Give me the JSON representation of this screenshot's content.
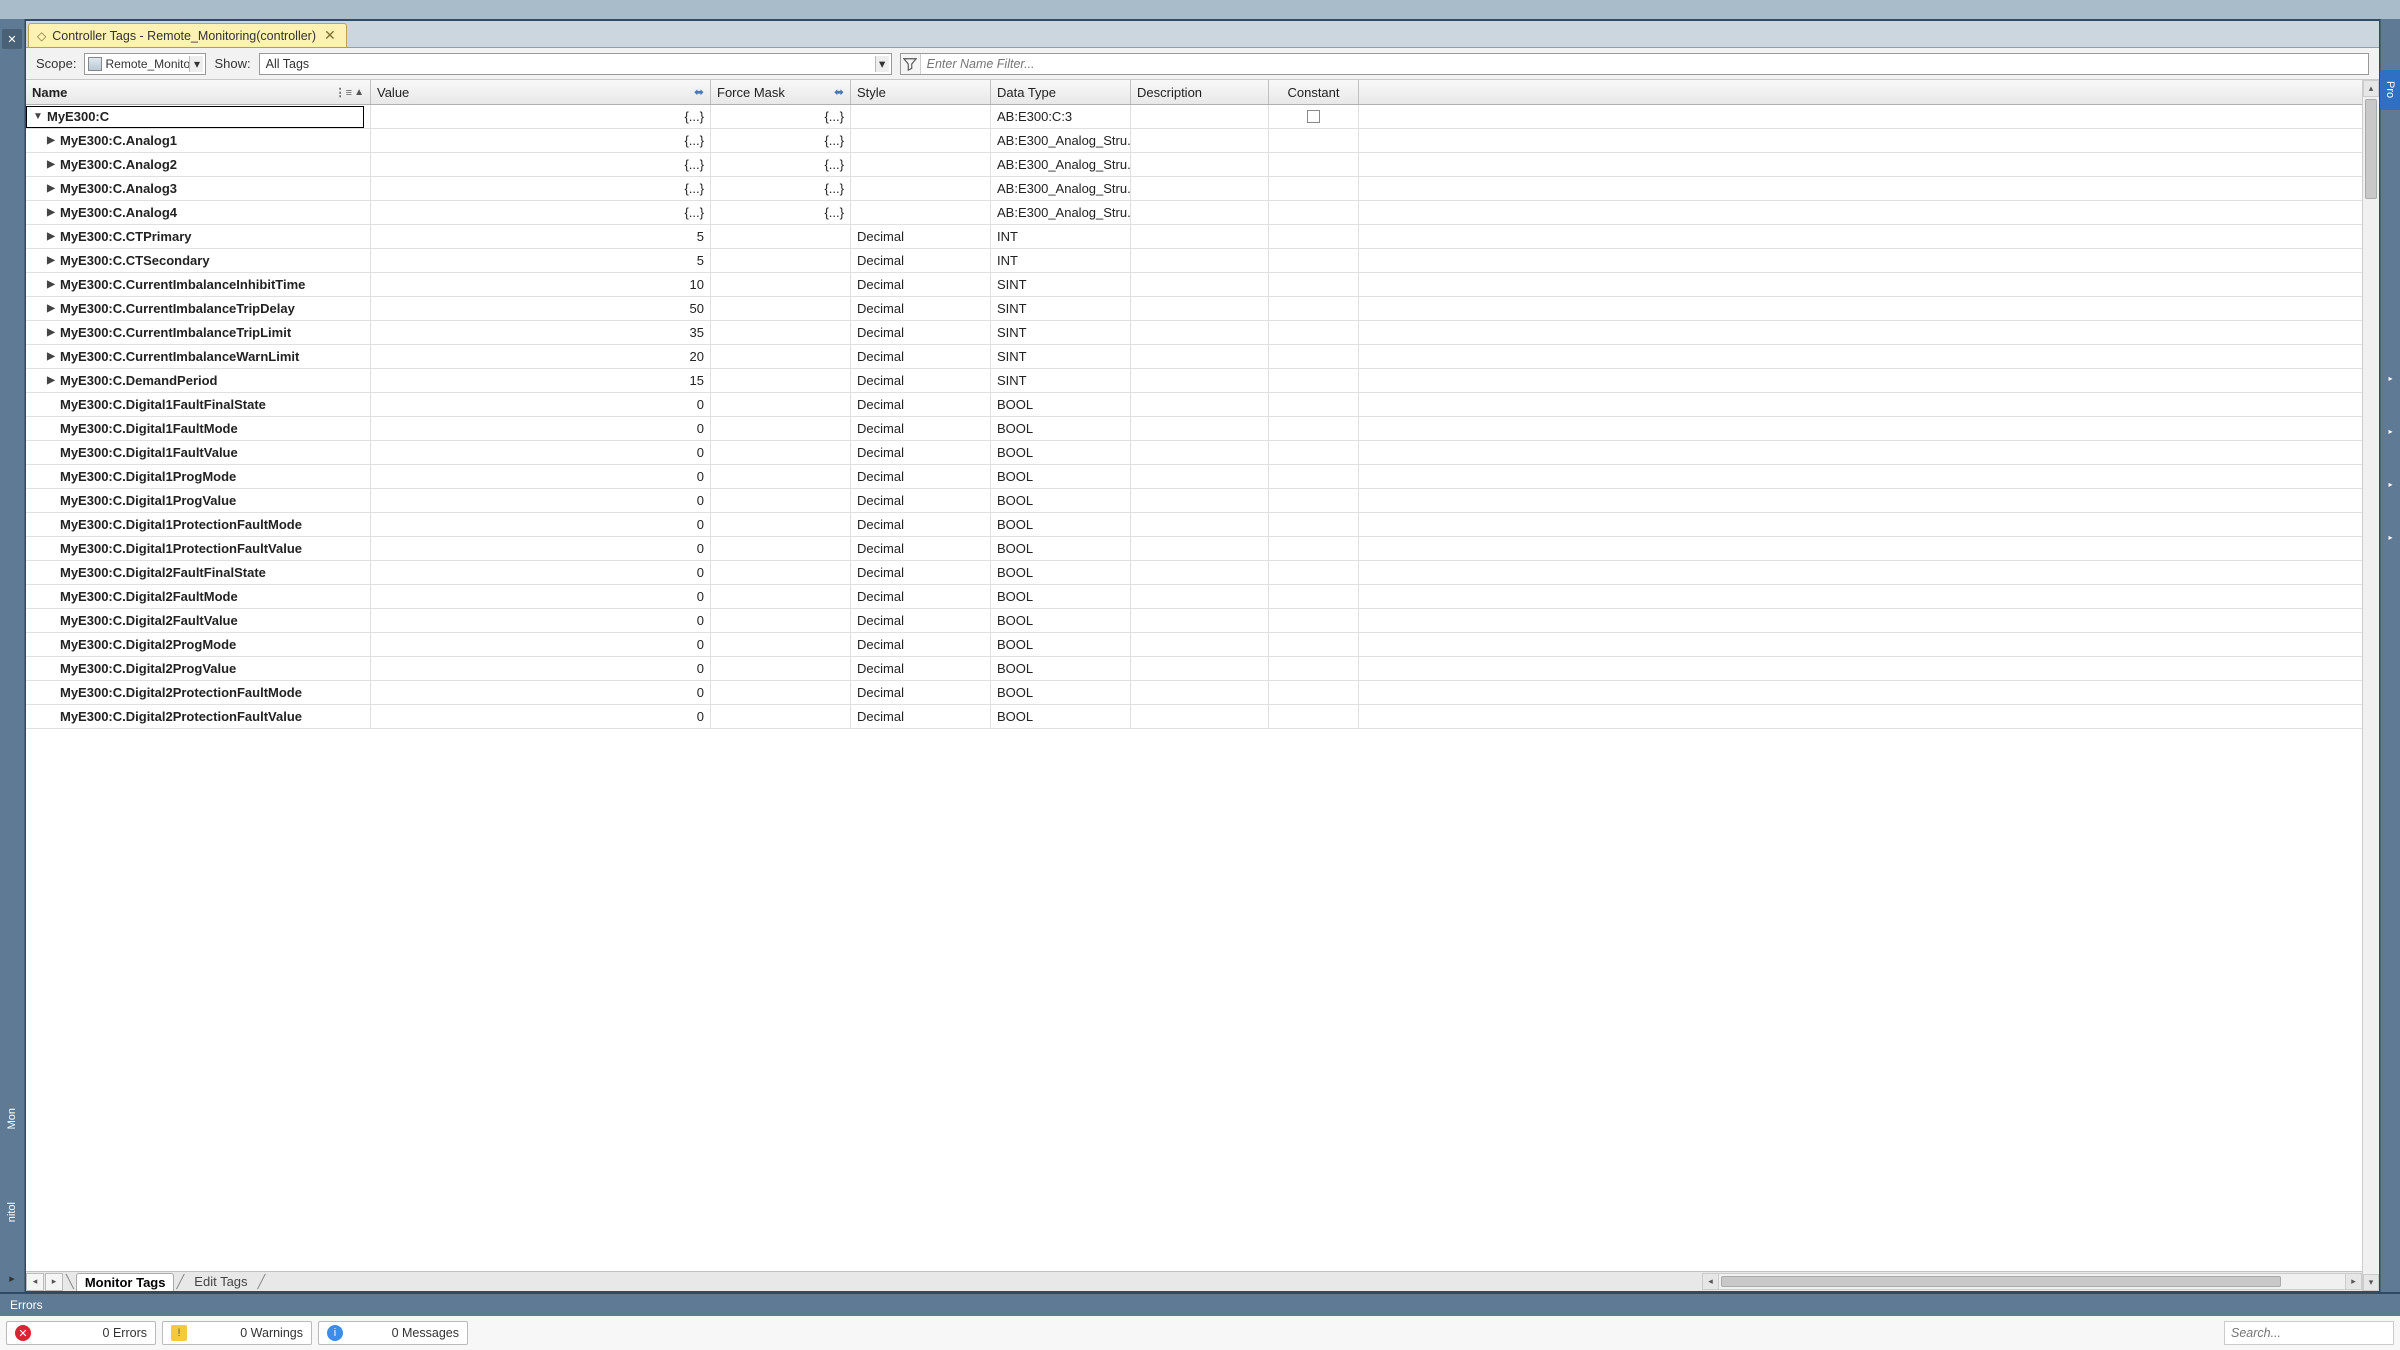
{
  "tab": {
    "title": "Controller Tags - Remote_Monitoring(controller)"
  },
  "filterbar": {
    "scope_label": "Scope:",
    "scope_value": "Remote_Monitori",
    "show_label": "Show:",
    "show_value": "All Tags",
    "namefilter_placeholder": "Enter Name Filter..."
  },
  "columns": {
    "name": "Name",
    "value": "Value",
    "force": "Force Mask",
    "style": "Style",
    "type": "Data Type",
    "desc": "Description",
    "const": "Constant"
  },
  "rows": [
    {
      "indent": 0,
      "expand": "open",
      "name": "MyE300:C",
      "value": "{...}",
      "force": "{...}",
      "style": "",
      "type": "AB:E300:C:3",
      "const": true,
      "selected": true
    },
    {
      "indent": 1,
      "expand": "close",
      "name": "MyE300:C.Analog1",
      "value": "{...}",
      "force": "{...}",
      "style": "",
      "type": "AB:E300_Analog_Stru..."
    },
    {
      "indent": 1,
      "expand": "close",
      "name": "MyE300:C.Analog2",
      "value": "{...}",
      "force": "{...}",
      "style": "",
      "type": "AB:E300_Analog_Stru..."
    },
    {
      "indent": 1,
      "expand": "close",
      "name": "MyE300:C.Analog3",
      "value": "{...}",
      "force": "{...}",
      "style": "",
      "type": "AB:E300_Analog_Stru..."
    },
    {
      "indent": 1,
      "expand": "close",
      "name": "MyE300:C.Analog4",
      "value": "{...}",
      "force": "{...}",
      "style": "",
      "type": "AB:E300_Analog_Stru..."
    },
    {
      "indent": 1,
      "expand": "close",
      "name": "MyE300:C.CTPrimary",
      "value": "5",
      "force": "",
      "style": "Decimal",
      "type": "INT"
    },
    {
      "indent": 1,
      "expand": "close",
      "name": "MyE300:C.CTSecondary",
      "value": "5",
      "force": "",
      "style": "Decimal",
      "type": "INT"
    },
    {
      "indent": 1,
      "expand": "close",
      "name": "MyE300:C.CurrentImbalanceInhibitTime",
      "value": "10",
      "force": "",
      "style": "Decimal",
      "type": "SINT"
    },
    {
      "indent": 1,
      "expand": "close",
      "name": "MyE300:C.CurrentImbalanceTripDelay",
      "value": "50",
      "force": "",
      "style": "Decimal",
      "type": "SINT"
    },
    {
      "indent": 1,
      "expand": "close",
      "name": "MyE300:C.CurrentImbalanceTripLimit",
      "value": "35",
      "force": "",
      "style": "Decimal",
      "type": "SINT"
    },
    {
      "indent": 1,
      "expand": "close",
      "name": "MyE300:C.CurrentImbalanceWarnLimit",
      "value": "20",
      "force": "",
      "style": "Decimal",
      "type": "SINT"
    },
    {
      "indent": 1,
      "expand": "close",
      "name": "MyE300:C.DemandPeriod",
      "value": "15",
      "force": "",
      "style": "Decimal",
      "type": "SINT"
    },
    {
      "indent": 1,
      "expand": "none",
      "name": "MyE300:C.Digital1FaultFinalState",
      "value": "0",
      "force": "",
      "style": "Decimal",
      "type": "BOOL"
    },
    {
      "indent": 1,
      "expand": "none",
      "name": "MyE300:C.Digital1FaultMode",
      "value": "0",
      "force": "",
      "style": "Decimal",
      "type": "BOOL"
    },
    {
      "indent": 1,
      "expand": "none",
      "name": "MyE300:C.Digital1FaultValue",
      "value": "0",
      "force": "",
      "style": "Decimal",
      "type": "BOOL"
    },
    {
      "indent": 1,
      "expand": "none",
      "name": "MyE300:C.Digital1ProgMode",
      "value": "0",
      "force": "",
      "style": "Decimal",
      "type": "BOOL"
    },
    {
      "indent": 1,
      "expand": "none",
      "name": "MyE300:C.Digital1ProgValue",
      "value": "0",
      "force": "",
      "style": "Decimal",
      "type": "BOOL"
    },
    {
      "indent": 1,
      "expand": "none",
      "name": "MyE300:C.Digital1ProtectionFaultMode",
      "value": "0",
      "force": "",
      "style": "Decimal",
      "type": "BOOL"
    },
    {
      "indent": 1,
      "expand": "none",
      "name": "MyE300:C.Digital1ProtectionFaultValue",
      "value": "0",
      "force": "",
      "style": "Decimal",
      "type": "BOOL"
    },
    {
      "indent": 1,
      "expand": "none",
      "name": "MyE300:C.Digital2FaultFinalState",
      "value": "0",
      "force": "",
      "style": "Decimal",
      "type": "BOOL"
    },
    {
      "indent": 1,
      "expand": "none",
      "name": "MyE300:C.Digital2FaultMode",
      "value": "0",
      "force": "",
      "style": "Decimal",
      "type": "BOOL"
    },
    {
      "indent": 1,
      "expand": "none",
      "name": "MyE300:C.Digital2FaultValue",
      "value": "0",
      "force": "",
      "style": "Decimal",
      "type": "BOOL"
    },
    {
      "indent": 1,
      "expand": "none",
      "name": "MyE300:C.Digital2ProgMode",
      "value": "0",
      "force": "",
      "style": "Decimal",
      "type": "BOOL"
    },
    {
      "indent": 1,
      "expand": "none",
      "name": "MyE300:C.Digital2ProgValue",
      "value": "0",
      "force": "",
      "style": "Decimal",
      "type": "BOOL"
    },
    {
      "indent": 1,
      "expand": "none",
      "name": "MyE300:C.Digital2ProtectionFaultMode",
      "value": "0",
      "force": "",
      "style": "Decimal",
      "type": "BOOL"
    },
    {
      "indent": 1,
      "expand": "none",
      "name": "MyE300:C.Digital2ProtectionFaultValue",
      "value": "0",
      "force": "",
      "style": "Decimal",
      "type": "BOOL"
    }
  ],
  "sheets": {
    "monitor": "Monitor Tags",
    "edit": "Edit Tags"
  },
  "left_dock": {
    "label1": "Mon",
    "label2": "nitol"
  },
  "right_dock": {
    "prop": "Pro"
  },
  "errors": {
    "title": "Errors",
    "err": "0 Errors",
    "warn": "0 Warnings",
    "msg": "0 Messages",
    "search_placeholder": "Search..."
  }
}
